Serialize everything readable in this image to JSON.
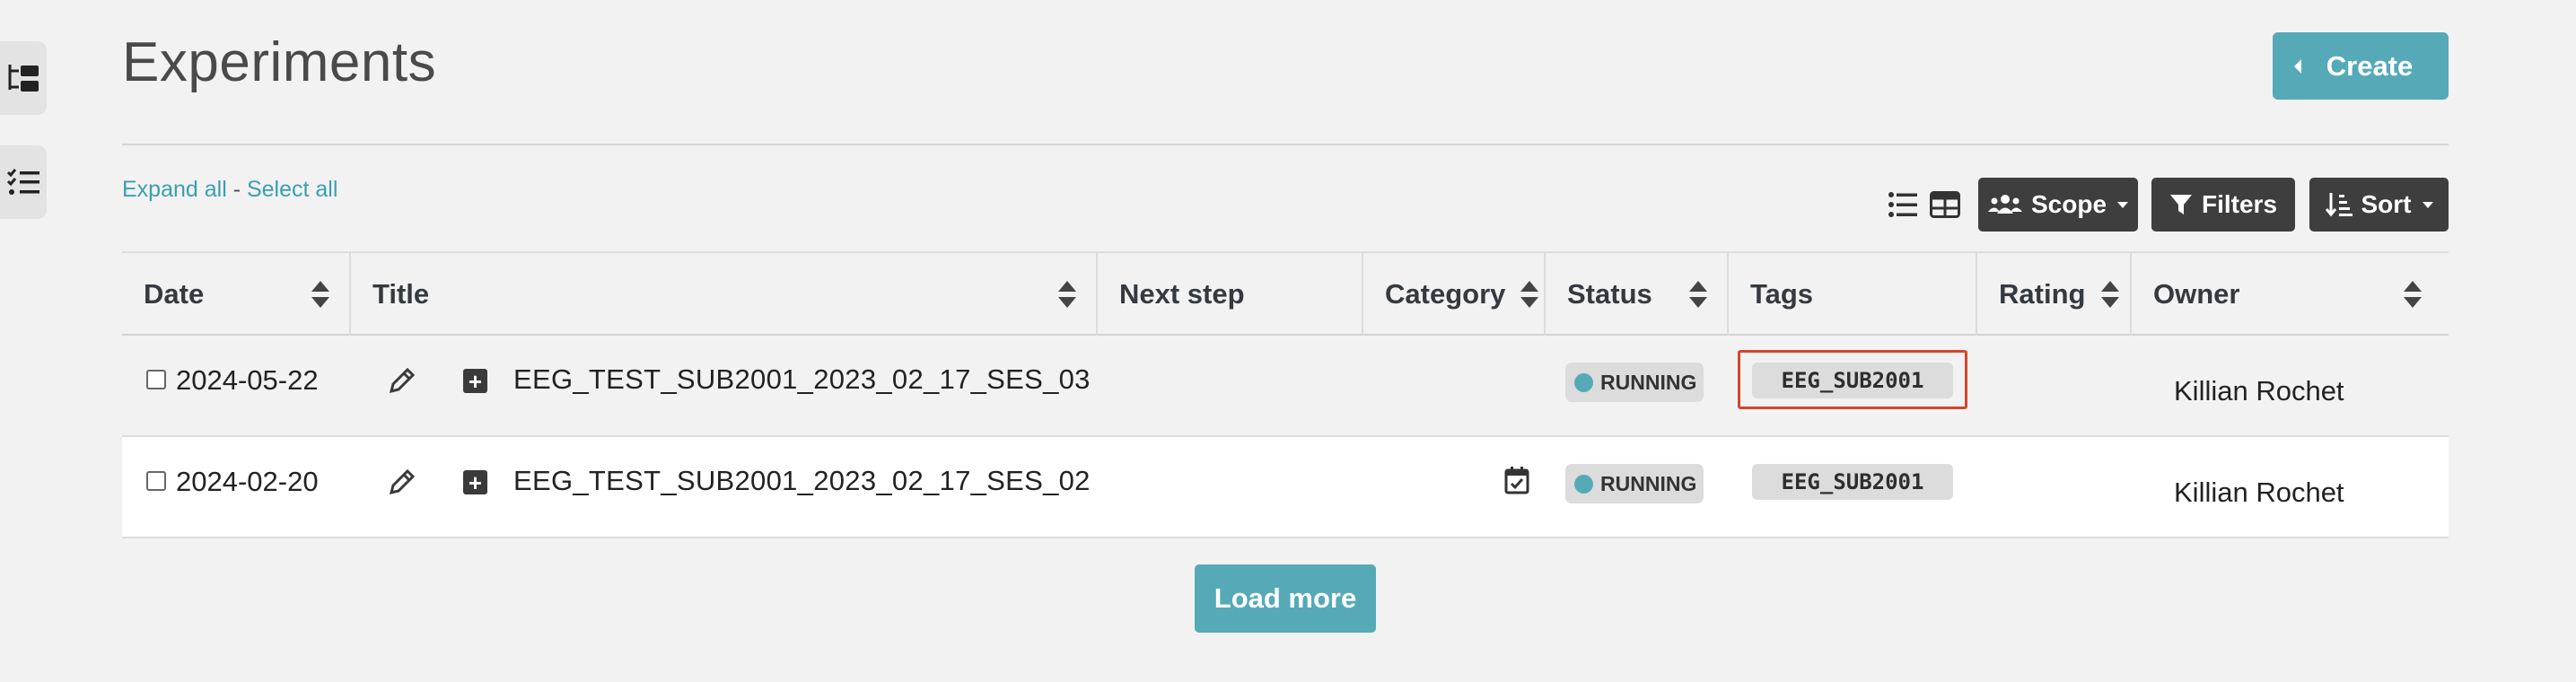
{
  "page": {
    "title": "Experiments"
  },
  "header": {
    "create_label": "Create"
  },
  "toolbar": {
    "expand_all": "Expand all",
    "separator": " - ",
    "select_all": "Select all",
    "scope_label": "Scope",
    "filters_label": "Filters",
    "sort_label": "Sort"
  },
  "table": {
    "columns": [
      {
        "label": "Date",
        "sortable": true
      },
      {
        "label": "Title",
        "sortable": true
      },
      {
        "label": "Next step",
        "sortable": false
      },
      {
        "label": "Category",
        "sortable": true
      },
      {
        "label": "Status",
        "sortable": true
      },
      {
        "label": "Tags",
        "sortable": false
      },
      {
        "label": "Rating",
        "sortable": true
      },
      {
        "label": "Owner",
        "sortable": true
      }
    ],
    "rows": [
      {
        "date": "2024-05-22",
        "title": "EEG_TEST_SUB2001_2023_02_17_SES_03",
        "next_step": "",
        "category_icon": "calendar-check-icon",
        "has_category": false,
        "status": "RUNNING",
        "tag": "EEG_SUB2001",
        "rating": "",
        "owner": "Killian Rochet",
        "highlighted_tag": true
      },
      {
        "date": "2024-02-20",
        "title": "EEG_TEST_SUB2001_2023_02_17_SES_02",
        "next_step": "",
        "category_icon": "calendar-check-icon",
        "has_category": true,
        "status": "RUNNING",
        "tag": "EEG_SUB2001",
        "rating": "",
        "owner": "Killian Rochet",
        "highlighted_tag": false
      }
    ]
  },
  "footer": {
    "load_more_label": "Load more"
  },
  "colors": {
    "accent": "#56aab7",
    "dark_button": "#3e3e3e",
    "link": "#3a9fb0",
    "highlight": "#d4462c"
  }
}
